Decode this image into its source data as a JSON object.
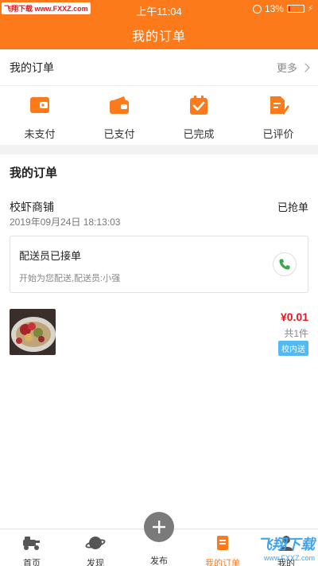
{
  "status_bar": {
    "watermark": "飞翔下载 www.FXXZ.com",
    "time": "上午11:04",
    "battery": "13%",
    "battery_level": 0.13
  },
  "header": {
    "title": "我的订单"
  },
  "summary": {
    "label": "我的订单",
    "more": "更多",
    "items": [
      {
        "label": "未支付",
        "icon": "unpaid-icon"
      },
      {
        "label": "已支付",
        "icon": "wallet-icon"
      },
      {
        "label": "已完成",
        "icon": "completed-icon"
      },
      {
        "label": "已评价",
        "icon": "review-icon"
      }
    ]
  },
  "orders": {
    "title": "我的订单",
    "order": {
      "shop": "校虾商铺",
      "status": "已抢单",
      "date": "2019年09月24日 18:13:03",
      "delivery_title": "配送员已接单",
      "delivery_sub": "开始为您配送,配送员:小强",
      "price": "¥0.01",
      "count": "共1件",
      "tag": "校内送"
    }
  },
  "tabbar": {
    "home": "首页",
    "discover": "发现",
    "publish": "发布",
    "my_orders": "我的订单",
    "mine": "我的"
  },
  "watermark": {
    "big": "飞翔下载",
    "small": "www.FXXZ.com"
  },
  "colors": {
    "accent": "#fd7a1b",
    "price": "#e8161d",
    "tag": "#52b9f5"
  }
}
